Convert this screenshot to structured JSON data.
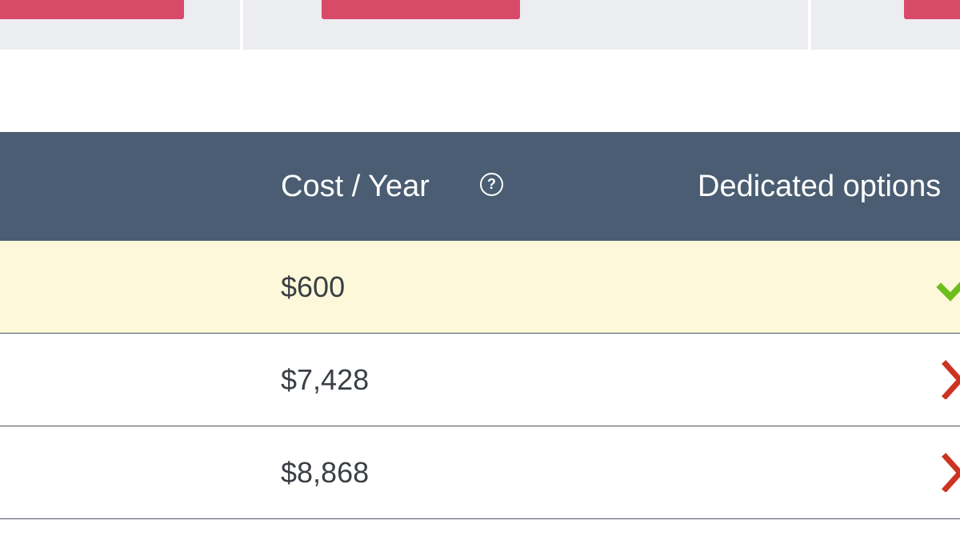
{
  "header": {
    "cost_label": "Cost / Year",
    "help_icon": "question-circle-icon",
    "dedicated_label": "Dedicated options"
  },
  "rows": [
    {
      "cost": "$600",
      "dedicated": "check-icon",
      "highlighted": true
    },
    {
      "cost": "$7,428",
      "dedicated": "x-icon",
      "highlighted": false
    },
    {
      "cost": "$8,868",
      "dedicated": "x-icon",
      "highlighted": false
    }
  ],
  "colors": {
    "accent_button": "#d94a69",
    "header_bg": "#4a5d72",
    "highlight_row_bg": "#fdf8d9",
    "check": "#6cbf1a",
    "cross": "#cc3322",
    "card_bg": "#ecedf0"
  }
}
